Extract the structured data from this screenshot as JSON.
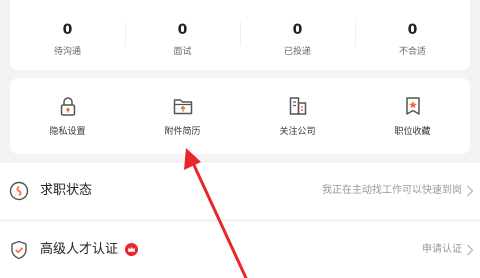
{
  "stats": [
    {
      "value": "0",
      "label": "待沟通"
    },
    {
      "value": "0",
      "label": "面试"
    },
    {
      "value": "0",
      "label": "已投递"
    },
    {
      "value": "0",
      "label": "不合适"
    }
  ],
  "tools": [
    {
      "label": "隐私设置",
      "icon": "lock-icon"
    },
    {
      "label": "附件简历",
      "icon": "folder-upload-icon"
    },
    {
      "label": "关注公司",
      "icon": "building-icon"
    },
    {
      "label": "职位收藏",
      "icon": "star-bookmark-icon"
    }
  ],
  "rows": [
    {
      "title": "求职状态",
      "value": "我正在主动找工作可以快速到岗",
      "icon": "status-icon"
    },
    {
      "title": "高级人才认证",
      "value": "申请认证",
      "icon": "shield-check-icon",
      "badge_icon": "crown-badge-icon"
    }
  ],
  "colors": {
    "accent": "#f26b3a",
    "arrow": "#e8262c",
    "background": "#f3f3f3"
  }
}
